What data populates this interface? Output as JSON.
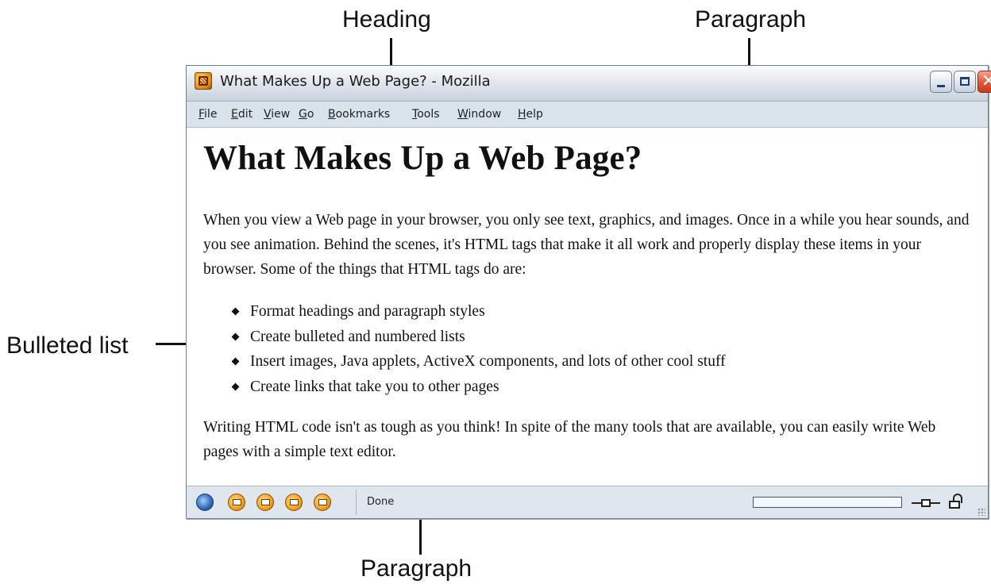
{
  "annotations": {
    "heading": "Heading",
    "paragraph_top": "Paragraph",
    "bulleted_list": "Bulleted list",
    "paragraph_bottom": "Paragraph"
  },
  "window": {
    "title": "What Makes Up a Web Page? - Mozilla",
    "close_glyph": "✕"
  },
  "menubar": {
    "items": [
      "File",
      "Edit",
      "View",
      "Go",
      "Bookmarks",
      "Tools",
      "Window",
      "Help"
    ]
  },
  "page": {
    "heading": "What Makes Up a Web Page?",
    "paragraph_1": "When you view a Web page in your browser, you only see text, graphics, and images. Once in a while you hear sounds, and you see animation. Behind the scenes, it's HTML tags that make it all work and properly display these items in your browser. Some of the things that HTML tags do are:",
    "bullets": [
      "Format headings and paragraph styles",
      "Create bulleted and numbered lists",
      "Insert images, Java applets, ActiveX components, and lots of other cool stuff",
      "Create links that take you to other pages"
    ],
    "paragraph_2": "Writing HTML code isn't as tough as you think! In spite of the many tools that are available, you can easily write Web pages with a simple text editor."
  },
  "statusbar": {
    "status_text": "Done",
    "progress_fraction": 0,
    "component_icons": [
      "navigator-icon",
      "mail-icon",
      "composer-icon",
      "address-book-icon",
      "chat-icon"
    ]
  },
  "colors": {
    "titlebar": "#dfe5ec",
    "menubar": "#d9e3ec",
    "statusbar": "#dfe6ee",
    "close_button": "#e0563a"
  }
}
